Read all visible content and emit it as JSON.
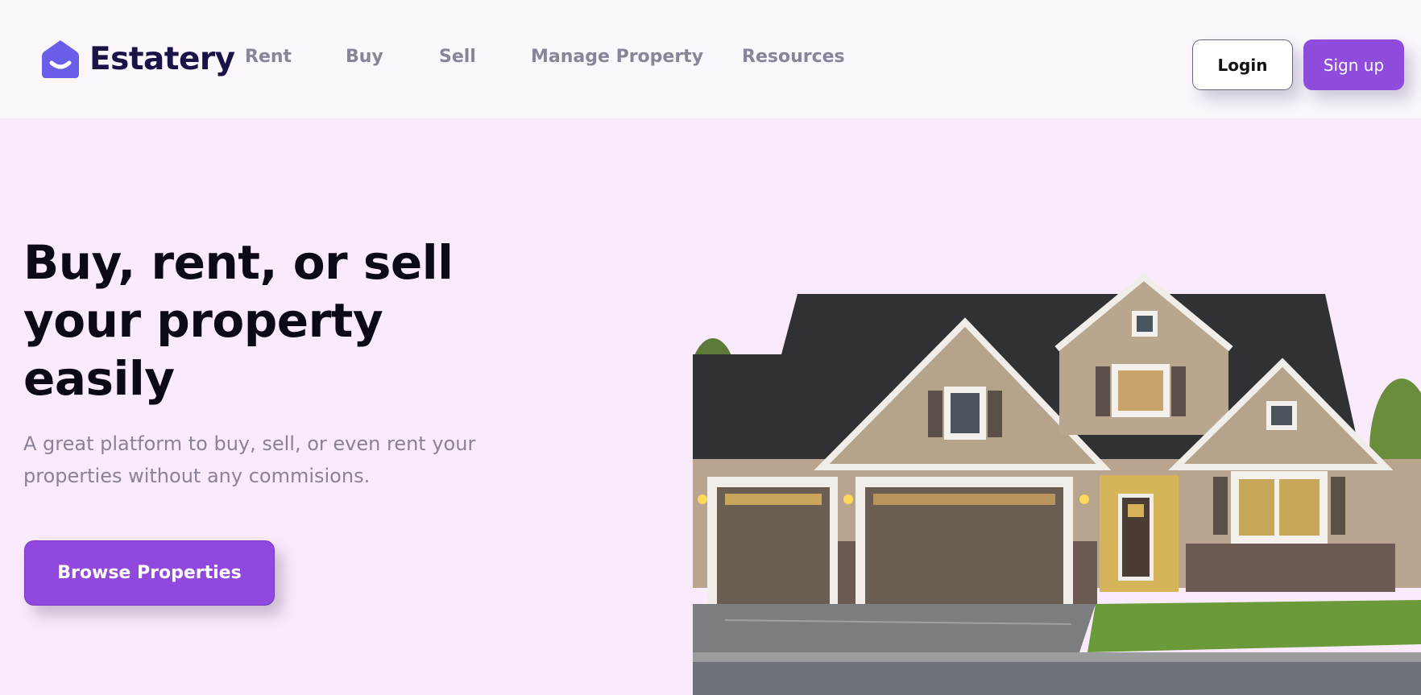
{
  "brand": {
    "name": "Estatery",
    "icon": "house-smile-logo-icon",
    "color": "#6a5de8"
  },
  "nav": {
    "items": [
      {
        "label": "Rent"
      },
      {
        "label": "Buy"
      },
      {
        "label": "Sell"
      },
      {
        "label": "Manage Property"
      },
      {
        "label": "Resources"
      }
    ]
  },
  "auth": {
    "login_label": "Login",
    "signup_label": "Sign up"
  },
  "hero": {
    "title": "Buy, rent, or sell your property easily",
    "subtitle": "A great platform to buy, sell, or even rent your properties without any commisions.",
    "cta_label": "Browse Properties",
    "image": "suburban-house-photo"
  },
  "colors": {
    "accent": "#8e4bdc",
    "background": "#f9ebfc",
    "header": "#fbf7fd"
  }
}
